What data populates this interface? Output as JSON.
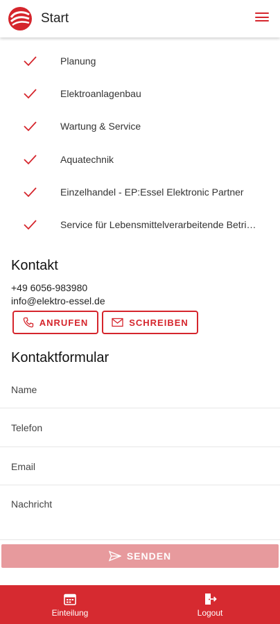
{
  "appbar": {
    "title": "Start"
  },
  "services": [
    {
      "label": "Planung"
    },
    {
      "label": "Elektroanlagenbau"
    },
    {
      "label": "Wartung & Service"
    },
    {
      "label": "Aquatechnik"
    },
    {
      "label": "Einzelhandel - EP:Essel Elektronic Partner"
    },
    {
      "label": "Service für Lebensmittelverarbeitende Betriebe"
    }
  ],
  "contact": {
    "heading": "Kontakt",
    "phone": "+49 6056-983980",
    "email": "info@elektro-essel.de",
    "call_label": "ANRUFEN",
    "write_label": "SCHREIBEN"
  },
  "form": {
    "heading": "Kontaktformular",
    "name_placeholder": "Name",
    "phone_placeholder": "Telefon",
    "email_placeholder": "Email",
    "message_placeholder": "Nachricht",
    "send_label": "SENDEN"
  },
  "bottom_nav": {
    "schedule_label": "Einteilung",
    "logout_label": "Logout"
  },
  "colors": {
    "accent": "#d5252c",
    "send_disabled": "#e79a9d",
    "nav_background": "#d62a30"
  },
  "icons": {
    "logo": "swoosh-logo-icon",
    "menu": "hamburger-menu-icon",
    "check": "checkmark-icon",
    "phone": "phone-icon",
    "mail": "envelope-icon",
    "send": "paper-plane-icon",
    "schedule": "calendar-icon",
    "logout": "logout-icon"
  }
}
